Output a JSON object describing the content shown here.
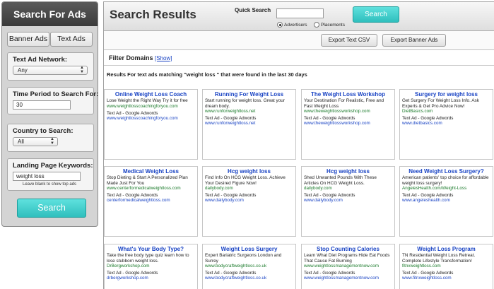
{
  "sidebar": {
    "title": "Search For Ads",
    "banner_btn": "Banner Ads",
    "text_btn": "Text Ads",
    "network_label": "Text Ad Network:",
    "network_value": "Any",
    "time_label": "Time Period to Search For:",
    "time_value": "30",
    "country_label": "Country to Search:",
    "country_value": "All",
    "keywords_label": "Landing Page Keywords:",
    "keywords_value": "weight loss",
    "keywords_hint": "Leave blank to show top ads",
    "search_btn": "Search"
  },
  "header": {
    "title": "Search Results",
    "quick_search_label": "Quick Search",
    "quick_search_value": "",
    "search_btn": "Search",
    "radio_advertisers": "Advertisers",
    "radio_placements": "Placements",
    "selected": "advertisers"
  },
  "export": {
    "text_csv": "Export Text CSV",
    "banner_ads": "Export Banner Ads"
  },
  "filter": {
    "label": "Filter Domains",
    "show": "[Show]"
  },
  "results_text": "Results For text ads matching \"weight loss \" that were found in the last 30 days",
  "ads": [
    {
      "title": "Online Weight Loss Coach",
      "desc": "Lose Weight the Right Way Try it for free",
      "url": "www.weightlosscoachingforyou.com",
      "network": "Text Ad - Google Adwords",
      "link": "www.weightlosscoachingforyou.com"
    },
    {
      "title": "Running For Weight Loss",
      "desc": "Start running for weight loss. Great your dream body.",
      "url": "www.runforweightloss.net",
      "network": "Text Ad - Google Adwords",
      "link": "www.runforweightloss.net"
    },
    {
      "title": "The Weight Loss Workshop",
      "desc": "Your Destination For Realistic, Free and Fast Weight Loss",
      "url": "www.theweightlossworkshop.com",
      "network": "Text Ad - Google Adwords",
      "link": "www.theweightlossworkshop.com"
    },
    {
      "title": "Surgery for weight loss",
      "desc": "Get Surgery For Weight Loss Info. Ask Experts & Get Pro Advice Now!",
      "url": "DietBasics.com",
      "network": "Text Ad - Google Adwords",
      "link": "www.dietbasics.com"
    },
    {
      "title": "Medical Weight Loss",
      "desc": "Stop Dieting & Start A Personalized Plan Made Just For You",
      "url": "www.centerformedicalweightloss.com",
      "network": "Text Ad - Google Adwords",
      "link": "centerformedicalweightloss.com"
    },
    {
      "title": "Hcg weight loss",
      "desc": "Find Info On HCG Weight Loss. Achieve Your Desired Figure Now!",
      "url": "dailybody.com",
      "network": "Text Ad - Google Adwords",
      "link": "www.dailybody.com"
    },
    {
      "title": "Hcg weight loss",
      "desc": "Shed Unwanted Pounds With These Articles On HCG Weight Loss.",
      "url": "dailybody.com",
      "network": "Text Ad - Google Adwords",
      "link": "www.dailybody.com"
    },
    {
      "title": "Need Weight Loss Surgery?",
      "desc": "American patients' top choice for affordable weight loss surgery!",
      "url": "AngelesHealth.com/Weight-Loss",
      "network": "Text Ad - Google Adwords",
      "link": "www.angeleshealth.com"
    },
    {
      "title": "What's Your Body Type?",
      "desc": "Take the free body type quiz learn how to lose stubborn weight loss.",
      "url": "DrBergworkshop.com",
      "network": "Text Ad - Google Adwords",
      "link": "drbergworkshop.com"
    },
    {
      "title": "Weight Loss Surgery",
      "desc": "Expert Bariatric Surgeons London and Surrey",
      "url": "www.bodycraftweightloss.co.uk",
      "network": "Text Ad - Google Adwords",
      "link": "www.bodycraftweightloss.co.uk"
    },
    {
      "title": "Stop Counting Calories",
      "desc": "Learn What Diet Programs Hide Eat Foods That Cause Fat Burning",
      "url": "www.weightlossmanagementnow.com",
      "network": "Text Ad - Google Adwords",
      "link": "www.weightlossmanagementnow.com"
    },
    {
      "title": "Weight Loss Program",
      "desc": "TN Residential Weight Loss Retreat. Complete Lifestyle Transformation!",
      "url": "fitnxweightloss.com",
      "network": "Text Ad - Google Adwords",
      "link": "www.fitnxweightloss.com"
    }
  ]
}
